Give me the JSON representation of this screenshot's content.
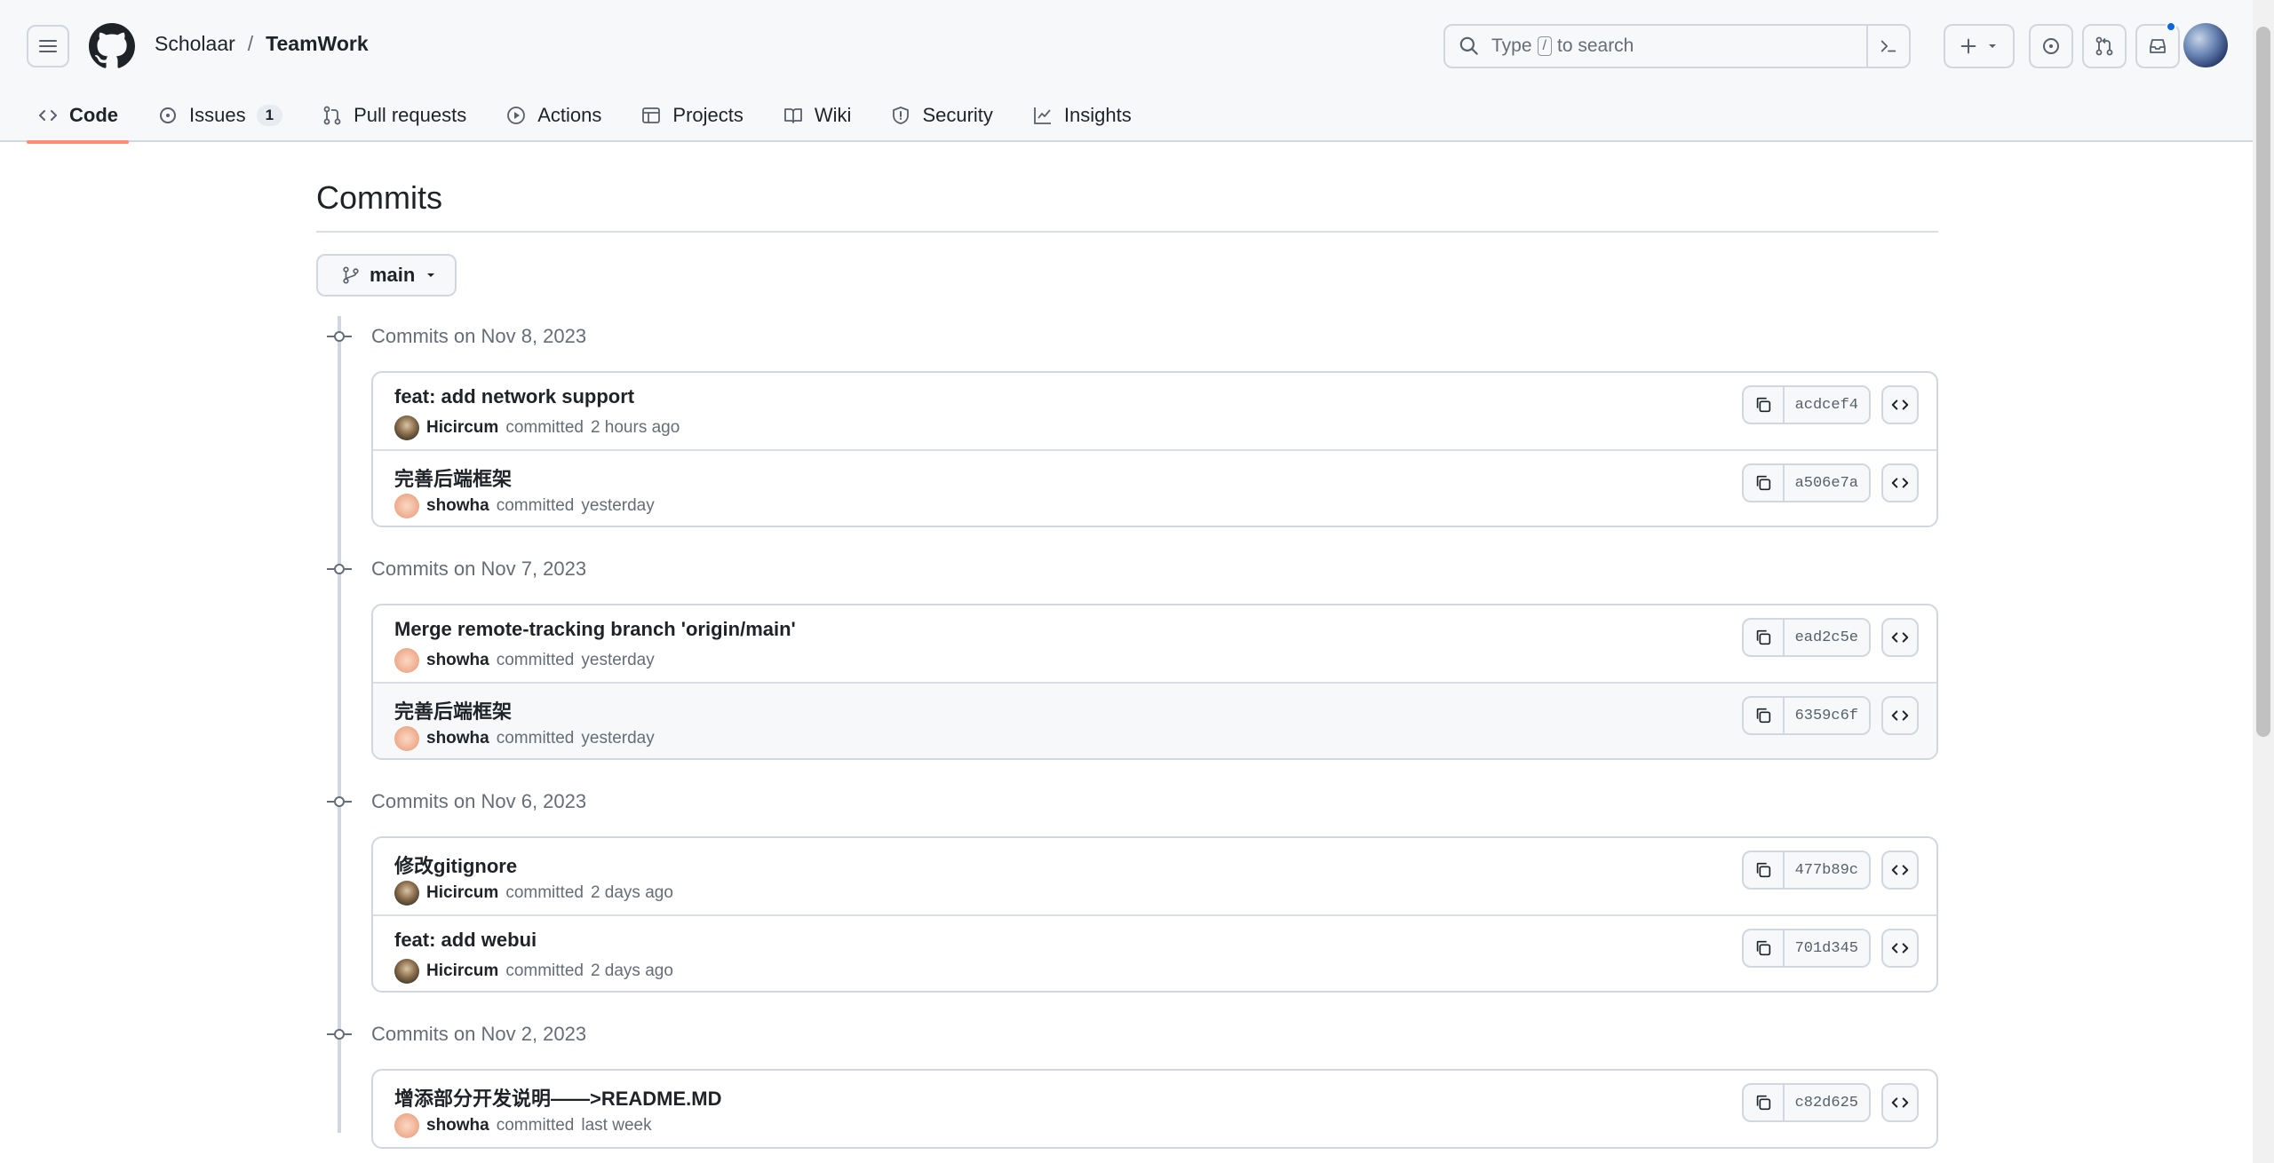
{
  "header": {
    "owner": "Scholaar",
    "separator": "/",
    "repo": "TeamWork",
    "search_placeholder_pre": "Type",
    "search_key": "/",
    "search_placeholder_post": "to search"
  },
  "tabs": [
    {
      "label": "Code",
      "icon": "code-icon",
      "active": true
    },
    {
      "label": "Issues",
      "icon": "issue-icon",
      "count": "1"
    },
    {
      "label": "Pull requests",
      "icon": "pull-request-icon"
    },
    {
      "label": "Actions",
      "icon": "play-icon"
    },
    {
      "label": "Projects",
      "icon": "table-icon"
    },
    {
      "label": "Wiki",
      "icon": "book-icon"
    },
    {
      "label": "Security",
      "icon": "shield-icon"
    },
    {
      "label": "Insights",
      "icon": "graph-icon"
    }
  ],
  "page": {
    "title": "Commits",
    "branch": "main"
  },
  "groups": [
    {
      "date_label": "Commits on Nov 8, 2023",
      "commits": [
        {
          "message": "feat: add network support",
          "author": "Hicircum",
          "action": "committed",
          "time": "2 hours ago",
          "sha": "acdcef4"
        },
        {
          "message": "完善后端框架",
          "author": "showha",
          "action": "committed",
          "time": "yesterday",
          "sha": "a506e7a"
        }
      ]
    },
    {
      "date_label": "Commits on Nov 7, 2023",
      "commits": [
        {
          "message": "Merge remote-tracking branch 'origin/main'",
          "author": "showha",
          "action": "committed",
          "time": "yesterday",
          "sha": "ead2c5e"
        },
        {
          "message": "完善后端框架",
          "author": "showha",
          "action": "committed",
          "time": "yesterday",
          "sha": "6359c6f"
        }
      ]
    },
    {
      "date_label": "Commits on Nov 6, 2023",
      "commits": [
        {
          "message": "修改gitignore",
          "author": "Hicircum",
          "action": "committed",
          "time": "2 days ago",
          "sha": "477b89c"
        },
        {
          "message": "feat: add webui",
          "author": "Hicircum",
          "action": "committed",
          "time": "2 days ago",
          "sha": "701d345"
        }
      ]
    },
    {
      "date_label": "Commits on Nov 2, 2023",
      "commits": [
        {
          "message": "增添部分开发说明——>README.MD",
          "author": "showha",
          "action": "committed",
          "time": "last week",
          "sha": "c82d625"
        }
      ]
    }
  ],
  "colors": {
    "accent_underline": "#fd8c73",
    "notification": "#0969da",
    "border": "#d0d7de"
  }
}
